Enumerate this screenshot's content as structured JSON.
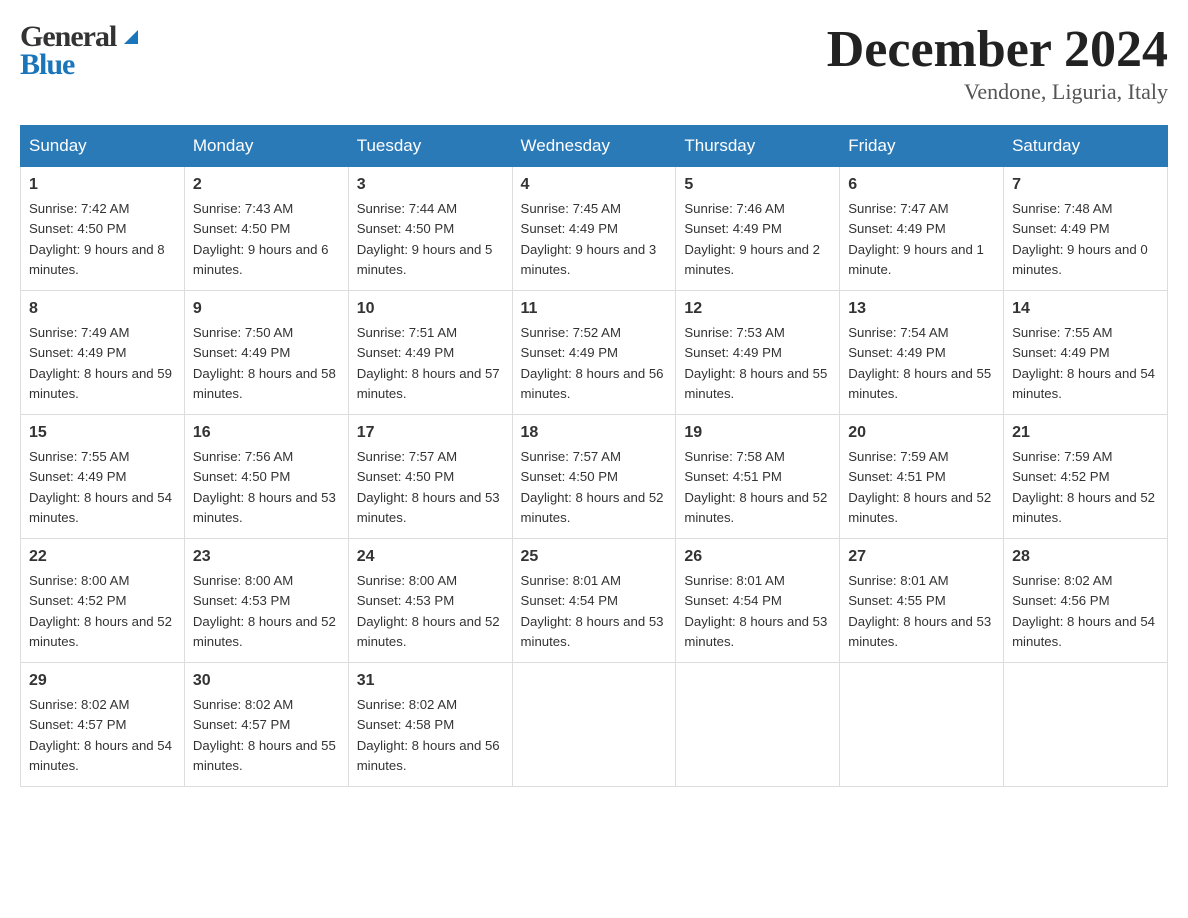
{
  "header": {
    "title": "December 2024",
    "subtitle": "Vendone, Liguria, Italy",
    "logo_general": "General",
    "logo_blue": "Blue"
  },
  "days_of_week": [
    "Sunday",
    "Monday",
    "Tuesday",
    "Wednesday",
    "Thursday",
    "Friday",
    "Saturday"
  ],
  "weeks": [
    [
      {
        "day": "1",
        "sunrise": "7:42 AM",
        "sunset": "4:50 PM",
        "daylight": "9 hours and 8 minutes."
      },
      {
        "day": "2",
        "sunrise": "7:43 AM",
        "sunset": "4:50 PM",
        "daylight": "9 hours and 6 minutes."
      },
      {
        "day": "3",
        "sunrise": "7:44 AM",
        "sunset": "4:50 PM",
        "daylight": "9 hours and 5 minutes."
      },
      {
        "day": "4",
        "sunrise": "7:45 AM",
        "sunset": "4:49 PM",
        "daylight": "9 hours and 3 minutes."
      },
      {
        "day": "5",
        "sunrise": "7:46 AM",
        "sunset": "4:49 PM",
        "daylight": "9 hours and 2 minutes."
      },
      {
        "day": "6",
        "sunrise": "7:47 AM",
        "sunset": "4:49 PM",
        "daylight": "9 hours and 1 minute."
      },
      {
        "day": "7",
        "sunrise": "7:48 AM",
        "sunset": "4:49 PM",
        "daylight": "9 hours and 0 minutes."
      }
    ],
    [
      {
        "day": "8",
        "sunrise": "7:49 AM",
        "sunset": "4:49 PM",
        "daylight": "8 hours and 59 minutes."
      },
      {
        "day": "9",
        "sunrise": "7:50 AM",
        "sunset": "4:49 PM",
        "daylight": "8 hours and 58 minutes."
      },
      {
        "day": "10",
        "sunrise": "7:51 AM",
        "sunset": "4:49 PM",
        "daylight": "8 hours and 57 minutes."
      },
      {
        "day": "11",
        "sunrise": "7:52 AM",
        "sunset": "4:49 PM",
        "daylight": "8 hours and 56 minutes."
      },
      {
        "day": "12",
        "sunrise": "7:53 AM",
        "sunset": "4:49 PM",
        "daylight": "8 hours and 55 minutes."
      },
      {
        "day": "13",
        "sunrise": "7:54 AM",
        "sunset": "4:49 PM",
        "daylight": "8 hours and 55 minutes."
      },
      {
        "day": "14",
        "sunrise": "7:55 AM",
        "sunset": "4:49 PM",
        "daylight": "8 hours and 54 minutes."
      }
    ],
    [
      {
        "day": "15",
        "sunrise": "7:55 AM",
        "sunset": "4:49 PM",
        "daylight": "8 hours and 54 minutes."
      },
      {
        "day": "16",
        "sunrise": "7:56 AM",
        "sunset": "4:50 PM",
        "daylight": "8 hours and 53 minutes."
      },
      {
        "day": "17",
        "sunrise": "7:57 AM",
        "sunset": "4:50 PM",
        "daylight": "8 hours and 53 minutes."
      },
      {
        "day": "18",
        "sunrise": "7:57 AM",
        "sunset": "4:50 PM",
        "daylight": "8 hours and 52 minutes."
      },
      {
        "day": "19",
        "sunrise": "7:58 AM",
        "sunset": "4:51 PM",
        "daylight": "8 hours and 52 minutes."
      },
      {
        "day": "20",
        "sunrise": "7:59 AM",
        "sunset": "4:51 PM",
        "daylight": "8 hours and 52 minutes."
      },
      {
        "day": "21",
        "sunrise": "7:59 AM",
        "sunset": "4:52 PM",
        "daylight": "8 hours and 52 minutes."
      }
    ],
    [
      {
        "day": "22",
        "sunrise": "8:00 AM",
        "sunset": "4:52 PM",
        "daylight": "8 hours and 52 minutes."
      },
      {
        "day": "23",
        "sunrise": "8:00 AM",
        "sunset": "4:53 PM",
        "daylight": "8 hours and 52 minutes."
      },
      {
        "day": "24",
        "sunrise": "8:00 AM",
        "sunset": "4:53 PM",
        "daylight": "8 hours and 52 minutes."
      },
      {
        "day": "25",
        "sunrise": "8:01 AM",
        "sunset": "4:54 PM",
        "daylight": "8 hours and 53 minutes."
      },
      {
        "day": "26",
        "sunrise": "8:01 AM",
        "sunset": "4:54 PM",
        "daylight": "8 hours and 53 minutes."
      },
      {
        "day": "27",
        "sunrise": "8:01 AM",
        "sunset": "4:55 PM",
        "daylight": "8 hours and 53 minutes."
      },
      {
        "day": "28",
        "sunrise": "8:02 AM",
        "sunset": "4:56 PM",
        "daylight": "8 hours and 54 minutes."
      }
    ],
    [
      {
        "day": "29",
        "sunrise": "8:02 AM",
        "sunset": "4:57 PM",
        "daylight": "8 hours and 54 minutes."
      },
      {
        "day": "30",
        "sunrise": "8:02 AM",
        "sunset": "4:57 PM",
        "daylight": "8 hours and 55 minutes."
      },
      {
        "day": "31",
        "sunrise": "8:02 AM",
        "sunset": "4:58 PM",
        "daylight": "8 hours and 56 minutes."
      },
      null,
      null,
      null,
      null
    ]
  ],
  "labels": {
    "sunrise": "Sunrise:",
    "sunset": "Sunset:",
    "daylight": "Daylight:"
  }
}
